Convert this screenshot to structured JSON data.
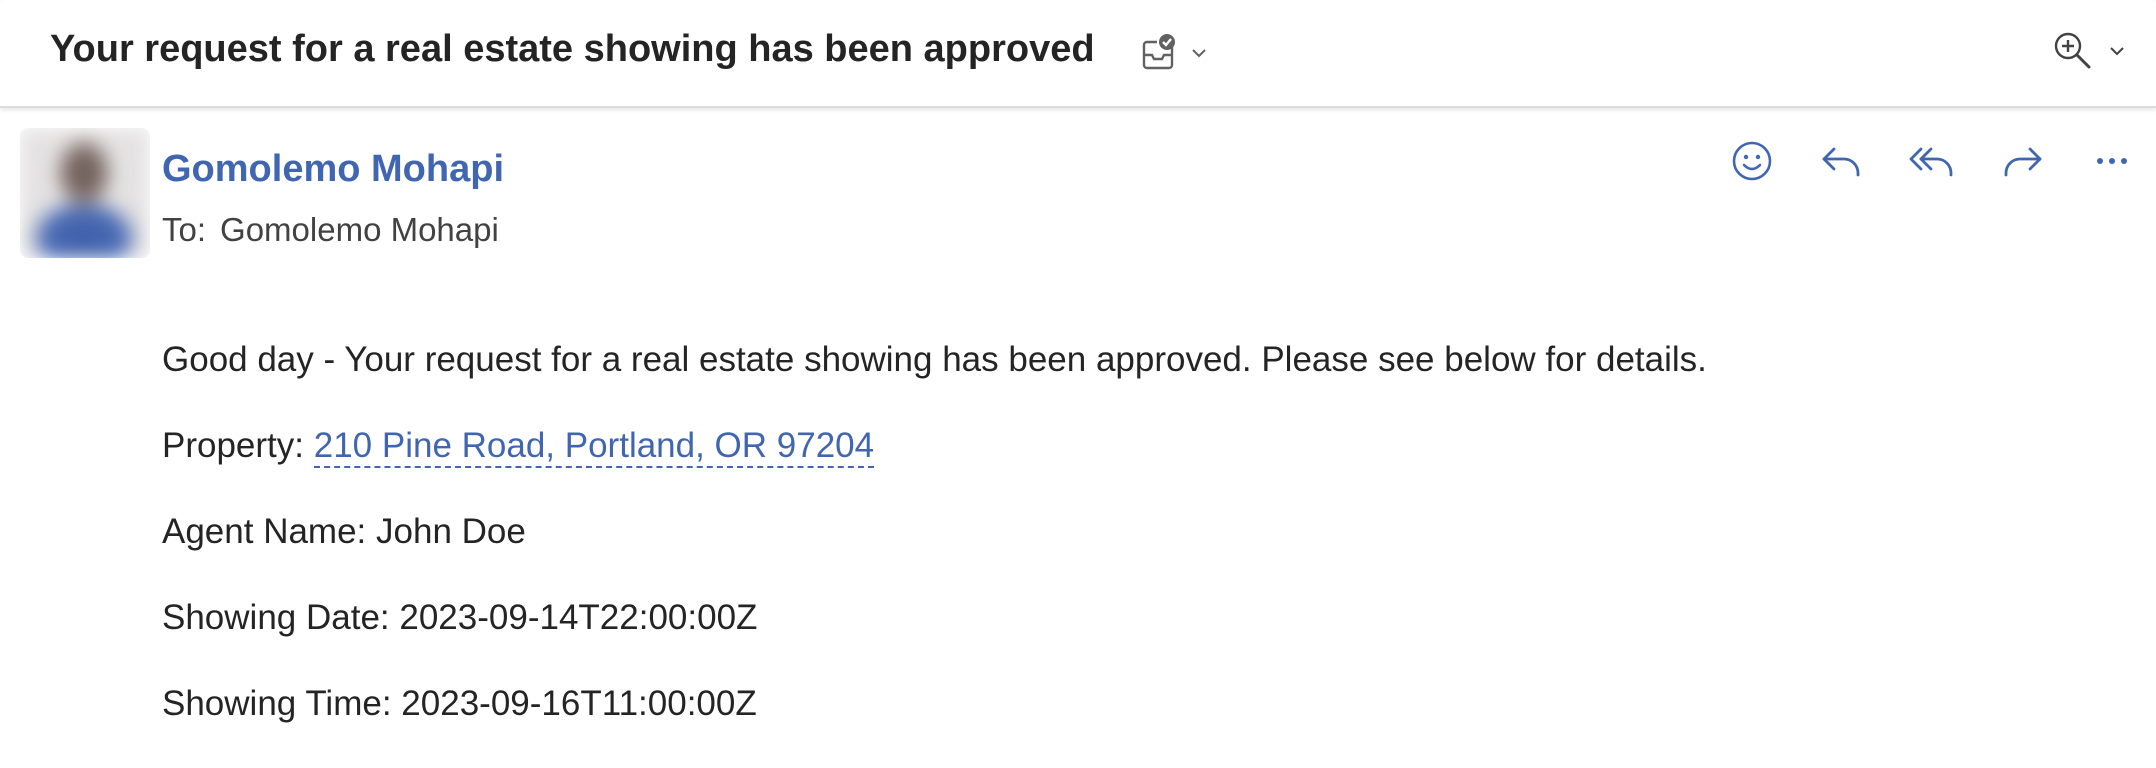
{
  "subject": "Your request for a real estate showing has been approved",
  "subject_icons": {
    "categorize": "inbox-check-icon",
    "dropdown": "chevron-down-icon",
    "zoom": "zoom-in-icon"
  },
  "sender": {
    "name": "Gomolemo Mohapi"
  },
  "to": {
    "label": "To:",
    "recipient": "Gomolemo Mohapi"
  },
  "actions": [
    "emoji-icon",
    "reply-icon",
    "reply-all-icon",
    "forward-icon",
    "more-icon"
  ],
  "body": {
    "intro": "Good day - Your request for a real estate showing has been approved. Please see below for details.",
    "property_label": "Property:",
    "property_value": "210 Pine Road, Portland, OR 97204",
    "agent_label": "Agent Name:",
    "agent_value": "John Doe",
    "date_label": "Showing Date:",
    "date_value": "2023-09-14T22:00:00Z",
    "time_label": "Showing Time:",
    "time_value": "2023-09-16T11:00:00Z"
  },
  "colors": {
    "accent": "#4166b1",
    "text": "#242424",
    "secondary_text": "#424242"
  }
}
